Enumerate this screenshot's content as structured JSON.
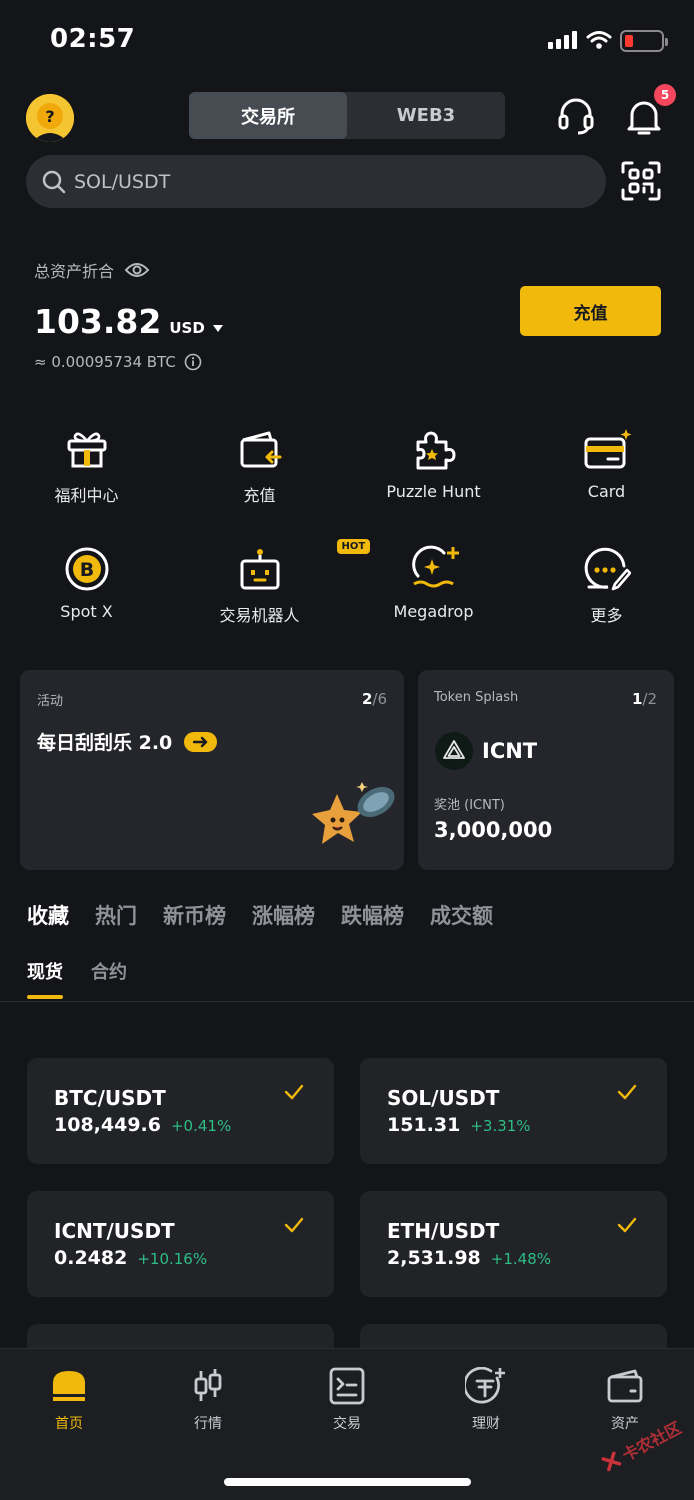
{
  "status": {
    "time": "02:57"
  },
  "header": {
    "tabs": [
      {
        "label": "交易所",
        "active": true
      },
      {
        "label": "WEB3",
        "active": false
      }
    ],
    "notif_count": "5"
  },
  "search": {
    "placeholder": "SOL/USDT"
  },
  "balance": {
    "label": "总资产折合",
    "amount": "103.82",
    "currency": "USD",
    "btc_equiv": "≈ 0.00095734 BTC",
    "deposit_label": "充值"
  },
  "quick": [
    {
      "label": "福利中心",
      "icon": "gift-icon"
    },
    {
      "label": "充值",
      "icon": "deposit-wallet-icon"
    },
    {
      "label": "Puzzle Hunt",
      "icon": "puzzle-icon"
    },
    {
      "label": "Card",
      "icon": "card-icon"
    },
    {
      "label": "Spot X",
      "icon": "bitcoin-icon"
    },
    {
      "label": "交易机器人",
      "icon": "robot-icon",
      "badge": "HOT"
    },
    {
      "label": "Megadrop",
      "icon": "megadrop-icon"
    },
    {
      "label": "更多",
      "icon": "more-icon"
    }
  ],
  "promo": {
    "activity": {
      "tag": "活动",
      "page_current": "2",
      "page_sep": "/6",
      "title": "每日刮刮乐 2.0"
    },
    "token_splash": {
      "tag": "Token Splash",
      "page_current": "1",
      "page_sep": "/2",
      "token": "ICNT",
      "pool_label": "奖池 (ICNT)",
      "pool_value": "3,000,000"
    }
  },
  "market_tabs": [
    "收藏",
    "热门",
    "新币榜",
    "涨幅榜",
    "跌幅榜",
    "成交额"
  ],
  "sub_tabs": [
    "现货",
    "合约"
  ],
  "favorites": [
    {
      "pair": "BTC/USDT",
      "price": "108,449.6",
      "change": "+0.41%"
    },
    {
      "pair": "SOL/USDT",
      "price": "151.31",
      "change": "+3.31%"
    },
    {
      "pair": "ICNT/USDT",
      "price": "0.2482",
      "change": "+10.16%"
    },
    {
      "pair": "ETH/USDT",
      "price": "2,531.98",
      "change": "+1.48%"
    }
  ],
  "nav": [
    {
      "label": "首页",
      "active": true
    },
    {
      "label": "行情",
      "active": false
    },
    {
      "label": "交易",
      "active": false
    },
    {
      "label": "理财",
      "active": false
    },
    {
      "label": "资产",
      "active": false
    }
  ],
  "watermark": "卡农社区",
  "colors": {
    "accent": "#f0b90b",
    "positive": "#2ebd85",
    "background": "#141518",
    "card": "#24262b"
  }
}
